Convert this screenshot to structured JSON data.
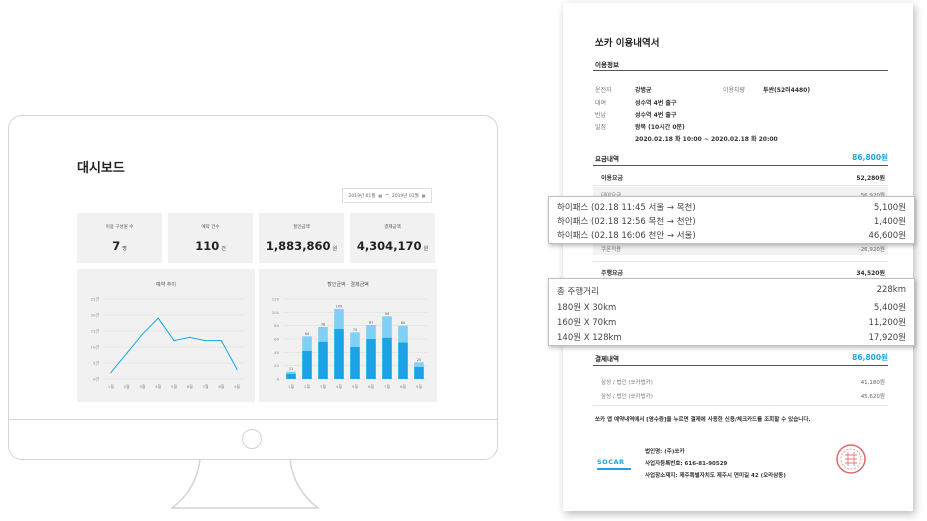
{
  "dashboard": {
    "title": "대시보드",
    "date_from": "2019년 01월",
    "date_tilde": "~",
    "date_to": "2019년 01월",
    "cards": [
      {
        "label": "이용 구성원 수",
        "value": "7",
        "unit": "명"
      },
      {
        "label": "예약 건수",
        "value": "110",
        "unit": "건"
      },
      {
        "label": "할인금액",
        "value": "1,883,860",
        "unit": "원"
      },
      {
        "label": "결제금액",
        "value": "4,304,170",
        "unit": "원"
      }
    ]
  },
  "chart_data": [
    {
      "type": "line",
      "title": "예약 추이",
      "categories": [
        "1월",
        "2월",
        "3월",
        "4월",
        "5월",
        "6월",
        "7월",
        "8월",
        "9월"
      ],
      "y_ticks": [
        "0건",
        "5건",
        "10건",
        "15건",
        "20건",
        "25건"
      ],
      "ylim": [
        0,
        25
      ],
      "values": [
        2,
        8,
        14,
        19,
        12,
        13,
        12,
        12,
        3
      ],
      "color": "#1aa4e6",
      "grid": true
    },
    {
      "type": "bar",
      "title": "할인금액 · 결제금액",
      "categories": [
        "1월",
        "2월",
        "3월",
        "4월",
        "5월",
        "6월",
        "7월",
        "8월",
        "9월"
      ],
      "y_ticks": [
        "0",
        "20",
        "40",
        "60",
        "80",
        "100",
        "120"
      ],
      "ylim": [
        0,
        120
      ],
      "series": [
        {
          "values": [
            8,
            42,
            56,
            75,
            48,
            60,
            62,
            55,
            18
          ],
          "color": "#1aa4e6"
        },
        {
          "values": [
            3,
            22,
            22,
            30,
            22,
            21,
            32,
            25,
            7
          ],
          "color": "#7fd0f6"
        }
      ],
      "data_labels": [
        "11",
        "64",
        "78",
        "105",
        "70",
        "81",
        "94",
        "80",
        "25"
      ],
      "stacked": true,
      "grid": true
    }
  ],
  "receipt": {
    "title": "쏘카 이용내역서",
    "usage_info_heading": "이용정보",
    "usage_info": [
      {
        "label": "운전자",
        "value": "강병균"
      },
      {
        "label": "대여",
        "value": "성수역 4번 출구"
      },
      {
        "label": "반납",
        "value": "성수역 4번 출구"
      },
      {
        "label": "일정",
        "value": "왕복 (10시간 0분)"
      }
    ],
    "schedule": "2020.02.18 화 10:00 ~ 2020.02.18 화 20:00",
    "car_label": "이용차량",
    "car_value": "투싼(52러4480)",
    "fee_heading": "요금내역",
    "fee_total": "86,800원",
    "fee_rows": [
      {
        "label": "이용요금",
        "value": "52,280원",
        "bold": true
      },
      {
        "label": "대여요금",
        "value": "56,920원",
        "bold": false
      },
      {
        "label": "쿠폰적용",
        "value": "-26,920원",
        "bold": false
      },
      {
        "label": "주행요금",
        "value": "34,520원",
        "bold": true
      }
    ],
    "payment_heading": "결제내역",
    "payment_total": "86,800원",
    "payment_rows": [
      {
        "label": "삼성 / 법인 (쏘카법카)",
        "value": "41,180원"
      },
      {
        "label": "삼성 / 법인 (쏘카법카)",
        "value": "45,620원"
      }
    ],
    "note": "쏘카 앱 예약내역에서 [영수증]을 누르면 결제에 사용한 신용/체크카드를 조회할 수 있습니다.",
    "company_logo": "SOCAR",
    "company_lines": [
      "법인명: (주)쏘카",
      "사업자등록번호: 616-81-90529",
      "사업장소재지: 제주특별자치도 제주시 연미길 42 (오라삼동)"
    ]
  },
  "callouts": {
    "tolls": [
      {
        "label": "하이패스 (02.18 11:45 서울 → 목천)",
        "value": "5,100원"
      },
      {
        "label": "하이패스 (02.18 12:56 목천 → 천안)",
        "value": "1,400원"
      },
      {
        "label": "하이패스 (02.18 16:06 천안 → 서울)",
        "value": "46,600원"
      }
    ],
    "distance": [
      {
        "label": "총 주행거리",
        "value": "228km"
      },
      {
        "label": "180원 X 30km",
        "value": "5,400원"
      },
      {
        "label": "160원 X 70km",
        "value": "11,200원"
      },
      {
        "label": "140원 X 128km",
        "value": "17,920원"
      }
    ]
  }
}
